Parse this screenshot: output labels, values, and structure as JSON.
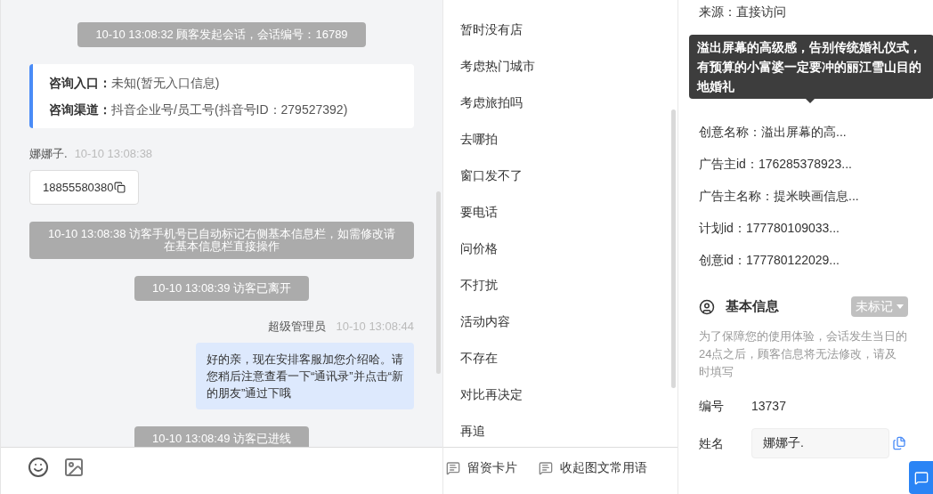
{
  "chat": {
    "messages": [
      {
        "kind": "system",
        "text": "10-10 13:08:32 顾客发起会话，会话编号：16789"
      },
      {
        "kind": "entry_card",
        "rows": [
          {
            "label": "咨询入口：",
            "value": "未知(暂无入口信息)"
          },
          {
            "label": "咨询渠道：",
            "value": "抖音企业号/员工号(抖音号ID：279527392)"
          }
        ]
      },
      {
        "kind": "visitor",
        "sender": "娜娜子.",
        "time": "10-10 13:08:38",
        "text": "18855580380"
      },
      {
        "kind": "system",
        "text": "10-10 13:08:38 访客手机号已自动标记右侧基本信息栏，如需修改请在基本信息栏直接操作"
      },
      {
        "kind": "system",
        "text": "10-10 13:08:39 访客已离开"
      },
      {
        "kind": "agent",
        "sender": "超级管理员",
        "time": "10-10 13:08:44",
        "text": "好的亲，现在安排客服加您介绍哈。请您稍后注意查看一下“通讯录”并点击“新的朋友”通过下哦"
      },
      {
        "kind": "system",
        "text": "10-10 13:08:49 访客已进线"
      }
    ]
  },
  "phrases": [
    "暂时没有店",
    "考虑热门城市",
    "考虑旅拍吗",
    "去哪拍",
    "窗口发不了",
    "要电话",
    "问价格",
    "不打扰",
    "活动内容",
    "不存在",
    "对比再决定",
    "再追"
  ],
  "phrase_actions": [
    "留资卡片",
    "收起图文常用语"
  ],
  "source_info_top": [
    "来源：直接访问"
  ],
  "source_info": [
    "创意名称：溢出屏幕的高...",
    "广告主id：176285378923...",
    "广告主名称：提米映画信息...",
    "计划id：177780109033...",
    "创意id：177780122029..."
  ],
  "tooltip": "溢出屏幕的高级感，告别传统婚礼仪式，有预算的小富婆一定要冲的丽江雪山目的地婚礼",
  "basic_info": {
    "title": "基本信息",
    "tag": "未标记",
    "notice": "为了保障您的使用体验，会话发生当日的24点之后，顾客信息将无法修改，请及时填写",
    "fields": [
      {
        "kind": "text",
        "label": "编号",
        "value": "13737"
      },
      {
        "kind": "input",
        "label": "姓名",
        "value": "娜娜子."
      }
    ]
  }
}
